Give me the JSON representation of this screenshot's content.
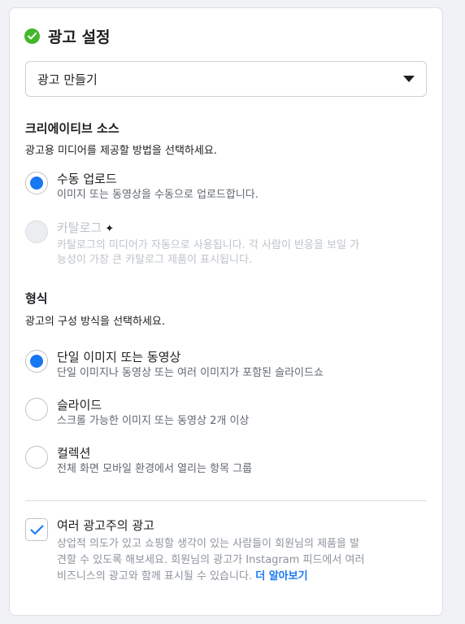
{
  "card": {
    "title": "광고 설정",
    "title_icon": "check-circle-icon",
    "accent_color": "#1877f2",
    "success_color": "#42b72a"
  },
  "ad_select": {
    "value": "광고 만들기",
    "icon": "caret-down-icon"
  },
  "creative_source": {
    "title": "크리에이티브 소스",
    "description": "광고용 미디어를 제공할 방법을 선택하세요.",
    "options": [
      {
        "label": "수동 업로드",
        "sub": "이미지 또는 동영상을 수동으로 업로드합니다.",
        "selected": true,
        "disabled": false
      },
      {
        "label": "카탈로그",
        "sub_line1": "카탈로그의 미디어가 자동으로 사용됩니다. 각 사람이 반응을 보일 가",
        "sub_line2": "능성이 가장 큰 카탈로그 제품이 표시됩니다.",
        "selected": false,
        "disabled": true,
        "icon": "sparkle-icon"
      }
    ]
  },
  "format": {
    "title": "형식",
    "description": "광고의 구성 방식을 선택하세요.",
    "options": [
      {
        "label": "단일 이미지 또는 동영상",
        "sub": "단일 이미지나 동영상 또는 여러 이미지가 포함된 슬라이드쇼",
        "selected": true
      },
      {
        "label": "슬라이드",
        "sub": "스크롤 가능한 이미지 또는 동영상 2개 이상",
        "selected": false
      },
      {
        "label": "컬렉션",
        "sub": "전체 화면 모바일 환경에서 열리는 항목 그룹",
        "selected": false
      }
    ]
  },
  "multi_advertiser": {
    "label": "여러 광고주의 광고",
    "checked": true,
    "desc_line1": "상업적 의도가 있고 쇼핑할 생각이 있는 사람들이 회원님의 제품을 발",
    "desc_line2": "견할 수 있도록 해보세요. 회원님의 광고가 Instagram 피드에서 여러",
    "desc_line3": "비즈니스의 광고와 함께 표시될 수 있습니다.",
    "link": "더 알아보기"
  }
}
